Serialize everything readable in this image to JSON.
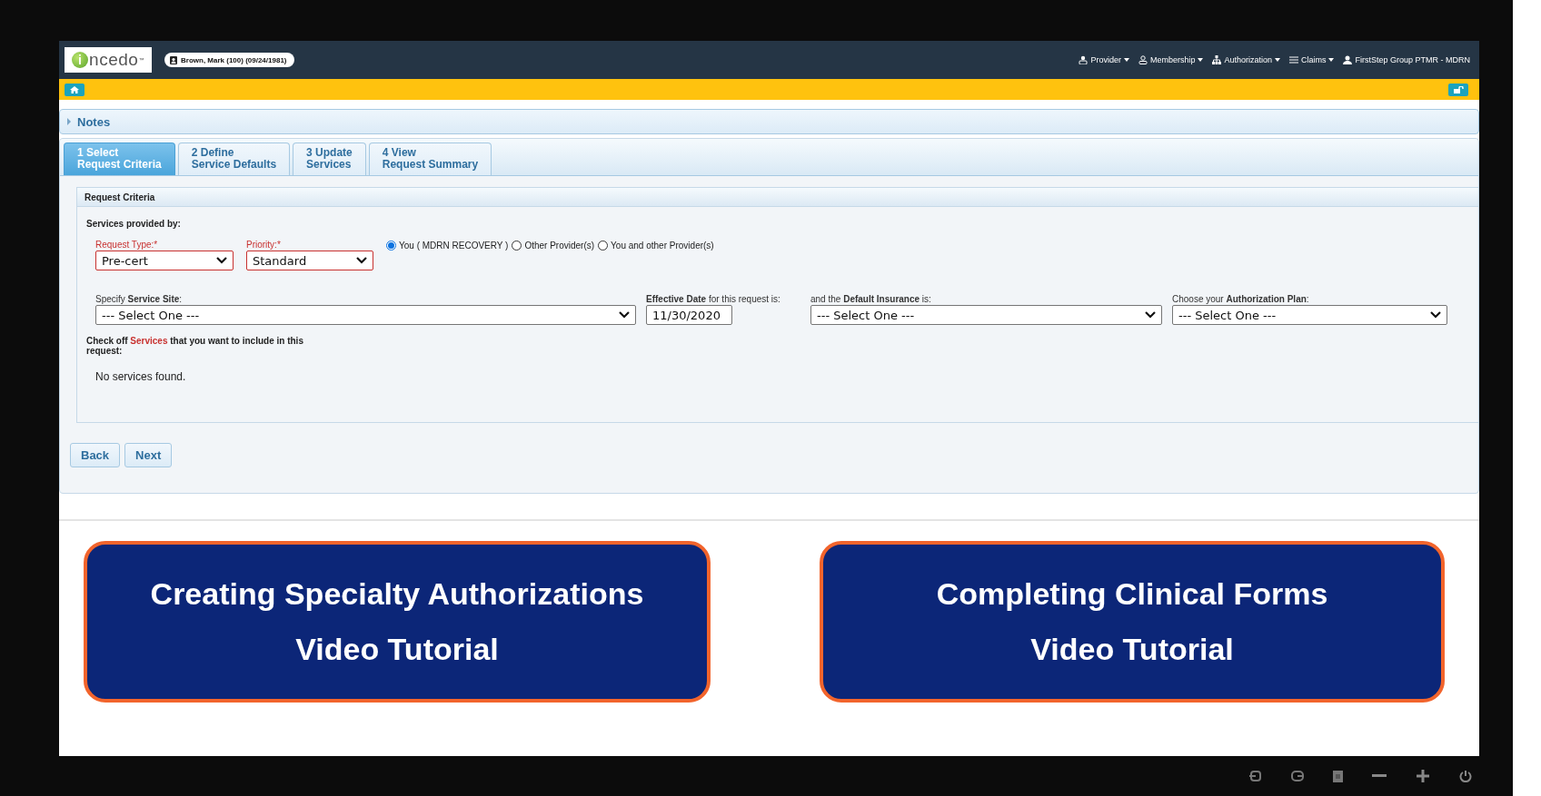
{
  "header": {
    "logo": {
      "initial": "i",
      "rest": "ncedo",
      "mark": "™"
    },
    "member": "Brown, Mark (100) (09/24/1981)",
    "menus": [
      {
        "label": "Provider",
        "kind": "provider"
      },
      {
        "label": "Membership",
        "kind": "membership"
      },
      {
        "label": "Authorization",
        "kind": "authorization"
      },
      {
        "label": "Claims",
        "kind": "claims"
      },
      {
        "label": "FirstStep Group PTMR - MDRN",
        "kind": "user"
      }
    ]
  },
  "notes": {
    "label": "Notes",
    "expanded": false
  },
  "tabs": [
    {
      "lines": [
        "1 Select",
        "Request Criteria"
      ],
      "selected": true
    },
    {
      "lines": [
        "2 Define",
        "Service Defaults"
      ],
      "selected": false
    },
    {
      "lines": [
        "3 Update",
        "Services"
      ],
      "selected": false
    },
    {
      "lines": [
        "4 View",
        "Request Summary"
      ],
      "selected": false
    }
  ],
  "criteria": {
    "title": "Request Criteria",
    "provided_by": "Services provided by:",
    "request_type": {
      "label": "Request Type:*",
      "value": "Pre-cert"
    },
    "priority": {
      "label": "Priority:*",
      "value": "Standard"
    },
    "providers": [
      {
        "label": "You ( MDRN RECOVERY )",
        "selected": true
      },
      {
        "label": "Other Provider(s)",
        "selected": false
      },
      {
        "label": "You and other Provider(s)",
        "selected": false
      }
    ],
    "service_site": {
      "label": "Specify **Service Site**:",
      "value": "--- Select One ---"
    },
    "effective_date": {
      "label": "**Effective Date** for this request is:",
      "value": "11/30/2020"
    },
    "insurance": {
      "label": "and the **Default Insurance** is:",
      "value": "--- Select One ---"
    },
    "plan": {
      "label": "Choose your **Authorization Plan**:",
      "value": "--- Select One ---"
    },
    "services_prompt": {
      "before": "Check off",
      "highlight": "Services",
      "after": "that you want to include in this request:"
    },
    "empty_message": "No services found."
  },
  "buttons": [
    "Back",
    "Next"
  ],
  "videos": [
    {
      "lines": [
        "Creating Specialty Authorizations",
        "Video Tutorial"
      ]
    },
    {
      "lines": [
        "Completing Clinical Forms",
        "Video Tutorial"
      ]
    }
  ]
}
